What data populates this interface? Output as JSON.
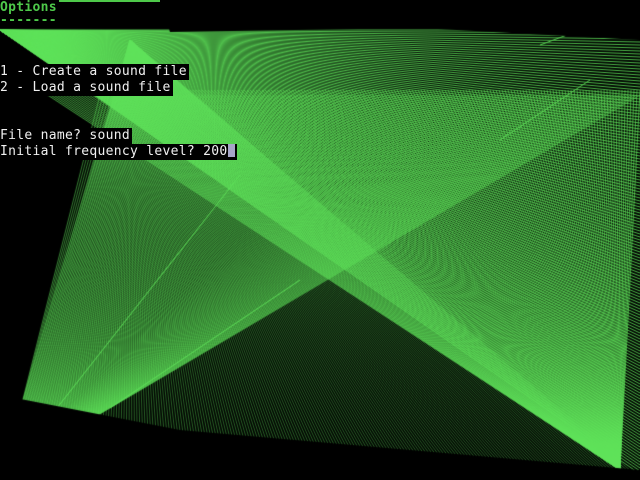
{
  "title": {
    "text": "Options",
    "underline": "-------"
  },
  "menu": {
    "items": [
      {
        "label": "1 - Create a sound file"
      },
      {
        "label": "2 - Load a sound file"
      }
    ]
  },
  "prompts": {
    "file_name": "File name? sound",
    "frequency": "Initial frequency level? 200"
  },
  "colors": {
    "background": "#000000",
    "pattern_green": "#5fe35a",
    "title_green": "#4ec94a",
    "text": "#f0f0f0",
    "cursor": "#a6a6c8"
  }
}
